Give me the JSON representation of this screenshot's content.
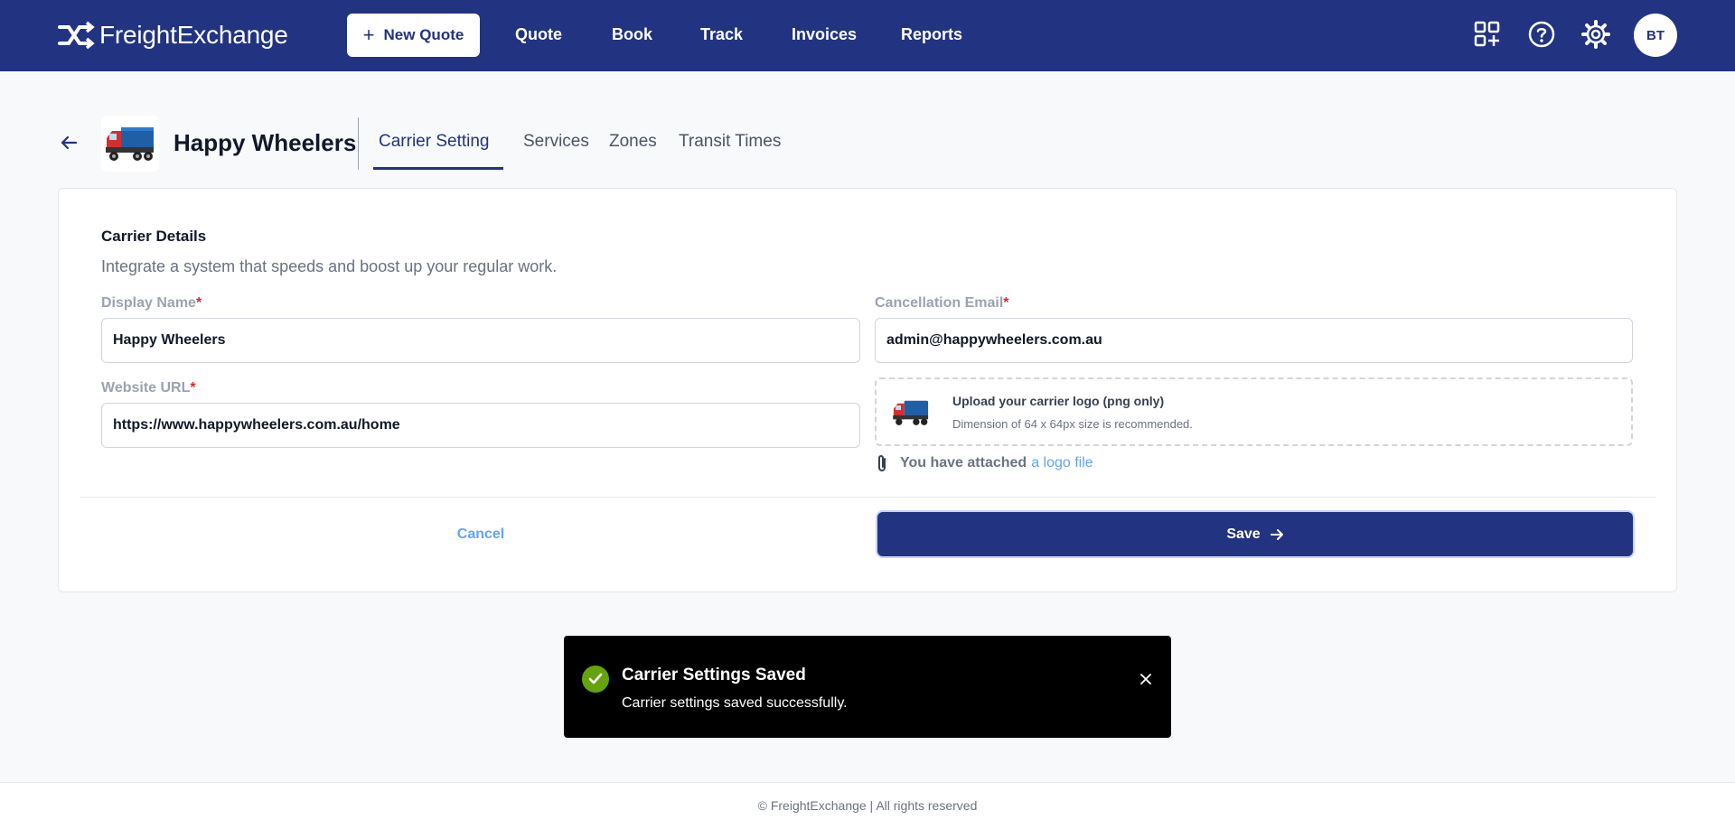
{
  "brand": {
    "name": "FreightExchange"
  },
  "topnav": {
    "new_quote_label": "New Quote",
    "items": [
      "Quote",
      "Book",
      "Track",
      "Invoices",
      "Reports"
    ],
    "icons": [
      "apps-add-icon",
      "help-icon",
      "settings-icon"
    ],
    "avatar_initials": "BT"
  },
  "carrier": {
    "name": "Happy Wheelers",
    "tabs": [
      "Carrier Setting",
      "Services",
      "Zones",
      "Transit Times"
    ],
    "active_tab": "Carrier Setting"
  },
  "form": {
    "title": "Carrier Details",
    "subtitle": "Integrate a system that speeds and boost up your regular work.",
    "display_name_label": "Display Name",
    "display_name_value": "Happy Wheelers",
    "website_label": "Website URL",
    "website_value": "https://www.happywheelers.com.au/home",
    "email_label": "Cancellation Email",
    "email_value": "admin@happywheelers.com.au",
    "required_mark": "*",
    "upload_title": "Upload your carrier logo (png only)",
    "upload_hint": "Dimension of 64 x 64px size is recommended.",
    "attached_text": "You have attached",
    "attached_link": "a logo file",
    "cancel_label": "Cancel",
    "save_label": "Save"
  },
  "toast": {
    "title": "Carrier Settings Saved",
    "message": "Carrier settings saved successfully."
  },
  "footer": {
    "text": "© FreightExchange | All rights reserved"
  },
  "colors": {
    "primary": "#223381",
    "link": "#60a5fa",
    "required": "#dc2626",
    "success": "#65a30d"
  }
}
